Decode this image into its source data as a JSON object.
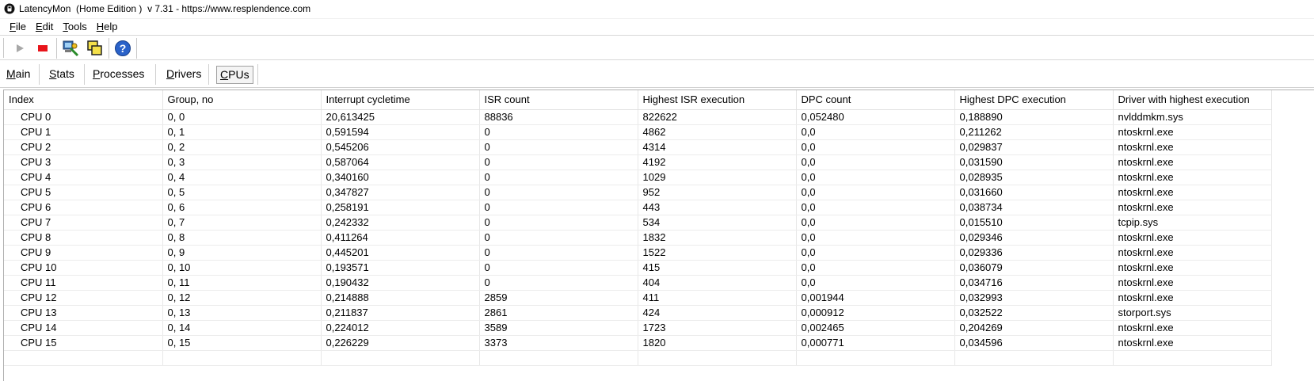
{
  "window": {
    "title": "LatencyMon  (Home Edition )  v 7.31 - https://www.resplendence.com"
  },
  "menu": {
    "items": [
      {
        "key": "F",
        "rest": "ile"
      },
      {
        "key": "E",
        "rest": "dit"
      },
      {
        "key": "T",
        "rest": "ools"
      },
      {
        "key": "H",
        "rest": "elp"
      }
    ]
  },
  "toolbar": {
    "buttons": [
      "play-icon",
      "stop-icon",
      "system-monitor-icon",
      "windows-icon",
      "help-icon"
    ]
  },
  "tabs": [
    {
      "key": "M",
      "rest": "ain",
      "active": false
    },
    {
      "key": "S",
      "rest": "tats",
      "active": false
    },
    {
      "key": "P",
      "rest": "rocesses",
      "active": false
    },
    {
      "key": "D",
      "rest": "rivers",
      "active": false
    },
    {
      "key": "C",
      "rest": "PUs",
      "active": true
    }
  ],
  "table": {
    "columns": [
      "Index",
      "Group, no",
      "Interrupt cycletime",
      "ISR count",
      "Highest ISR execution",
      "DPC count",
      "Highest DPC execution",
      "Driver with highest execution"
    ],
    "rows": [
      [
        "CPU 0",
        "0, 0",
        "20,613425",
        "88836",
        "822622",
        "0,052480",
        "0,188890",
        "nvlddmkm.sys"
      ],
      [
        "CPU 1",
        "0, 1",
        "0,591594",
        "0",
        "4862",
        "0,0",
        "0,211262",
        "ntoskrnl.exe"
      ],
      [
        "CPU 2",
        "0, 2",
        "0,545206",
        "0",
        "4314",
        "0,0",
        "0,029837",
        "ntoskrnl.exe"
      ],
      [
        "CPU 3",
        "0, 3",
        "0,587064",
        "0",
        "4192",
        "0,0",
        "0,031590",
        "ntoskrnl.exe"
      ],
      [
        "CPU 4",
        "0, 4",
        "0,340160",
        "0",
        "1029",
        "0,0",
        "0,028935",
        "ntoskrnl.exe"
      ],
      [
        "CPU 5",
        "0, 5",
        "0,347827",
        "0",
        "952",
        "0,0",
        "0,031660",
        "ntoskrnl.exe"
      ],
      [
        "CPU 6",
        "0, 6",
        "0,258191",
        "0",
        "443",
        "0,0",
        "0,038734",
        "ntoskrnl.exe"
      ],
      [
        "CPU 7",
        "0, 7",
        "0,242332",
        "0",
        "534",
        "0,0",
        "0,015510",
        "tcpip.sys"
      ],
      [
        "CPU 8",
        "0, 8",
        "0,411264",
        "0",
        "1832",
        "0,0",
        "0,029346",
        "ntoskrnl.exe"
      ],
      [
        "CPU 9",
        "0, 9",
        "0,445201",
        "0",
        "1522",
        "0,0",
        "0,029336",
        "ntoskrnl.exe"
      ],
      [
        "CPU 10",
        "0, 10",
        "0,193571",
        "0",
        "415",
        "0,0",
        "0,036079",
        "ntoskrnl.exe"
      ],
      [
        "CPU 11",
        "0, 11",
        "0,190432",
        "0",
        "404",
        "0,0",
        "0,034716",
        "ntoskrnl.exe"
      ],
      [
        "CPU 12",
        "0, 12",
        "0,214888",
        "2859",
        "411",
        "0,001944",
        "0,032993",
        "ntoskrnl.exe"
      ],
      [
        "CPU 13",
        "0, 13",
        "0,211837",
        "2861",
        "424",
        "0,000912",
        "0,032522",
        "storport.sys"
      ],
      [
        "CPU 14",
        "0, 14",
        "0,224012",
        "3589",
        "1723",
        "0,002465",
        "0,204269",
        "ntoskrnl.exe"
      ],
      [
        "CPU 15",
        "0, 15",
        "0,226229",
        "3373",
        "1820",
        "0,000771",
        "0,034596",
        "ntoskrnl.exe"
      ]
    ]
  }
}
